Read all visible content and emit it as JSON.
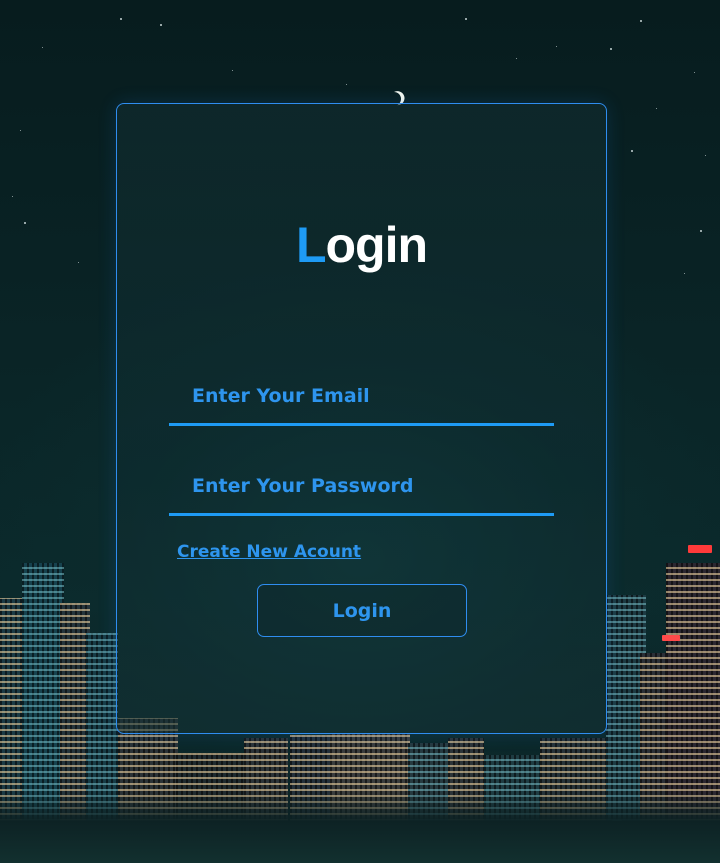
{
  "login_card": {
    "title_first_letter": "L",
    "title_rest": "ogin",
    "email_placeholder": "Enter Your Email",
    "password_placeholder": "Enter Your Password",
    "create_account_link": "Create New Acount",
    "login_button": "Login"
  },
  "colors": {
    "accent": "#1e9bf5",
    "title_text": "#ffffff",
    "border": "#2f8df0"
  },
  "background": {
    "scene": "night-city-skyline",
    "icons": [
      "moon-icon"
    ]
  }
}
